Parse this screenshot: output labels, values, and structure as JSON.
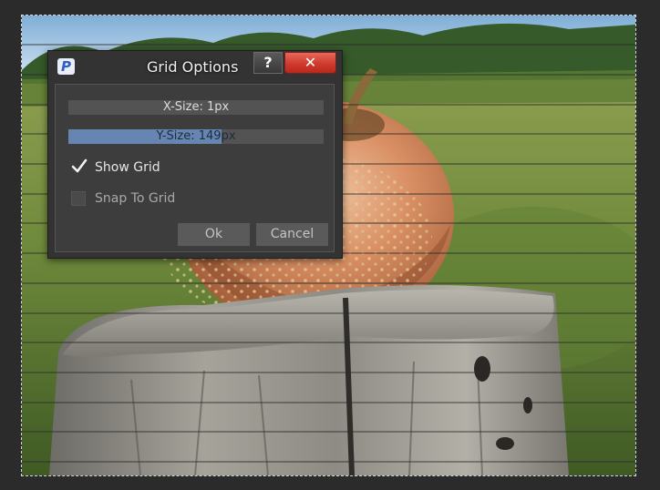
{
  "dialog": {
    "app_icon_letter": "P",
    "title": "Grid Options",
    "help_label": "?",
    "close_label": "✕",
    "x_size": {
      "label": "X-Size: 1px",
      "value": 1,
      "fill_fraction": 0.0
    },
    "y_size": {
      "label": "Y-Size: 149px",
      "value": 149,
      "fill_fraction": 0.6
    },
    "show_grid": {
      "label": "Show Grid",
      "checked": true
    },
    "snap_to_grid": {
      "label": "Snap To Grid",
      "checked": false,
      "enabled": false
    },
    "ok_label": "Ok",
    "cancel_label": "Cancel"
  },
  "canvas": {
    "image_subject": "apple-on-tree-stump-photo",
    "grid_line_color": "#2a2a2a"
  },
  "colors": {
    "slider_fill": "#6685b0",
    "close_button": "#cf3b2d",
    "dialog_bg": "#333333"
  }
}
